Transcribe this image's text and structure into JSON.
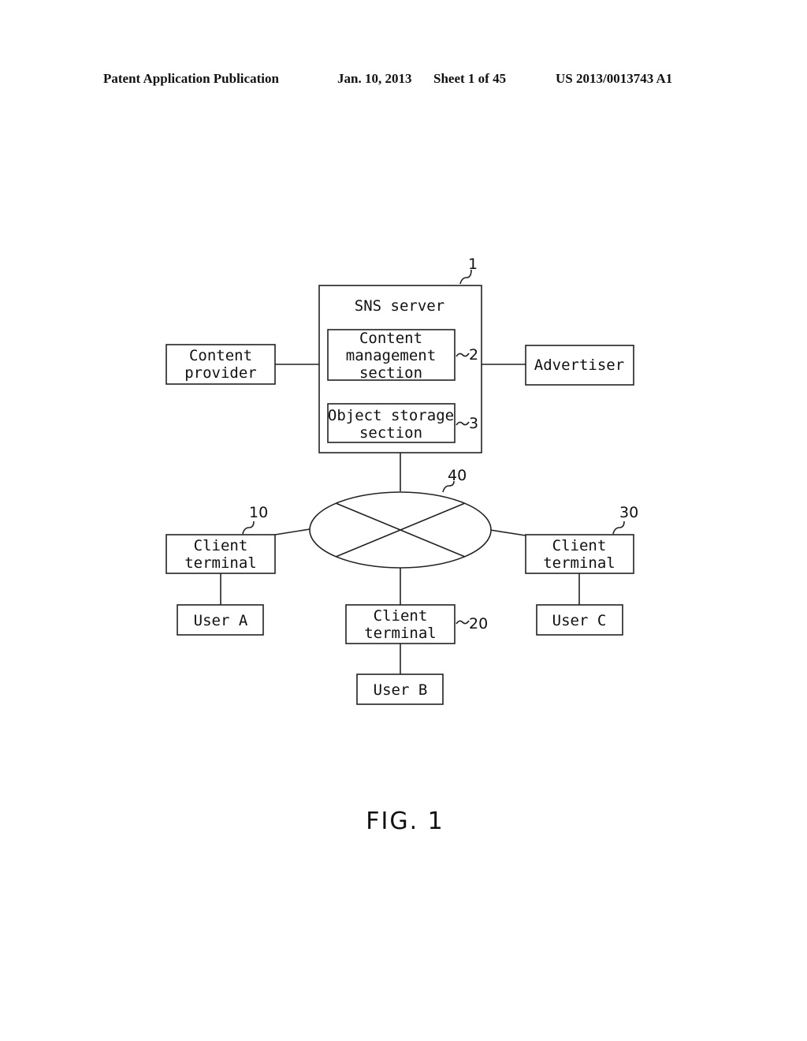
{
  "header": {
    "publication": "Patent Application Publication",
    "date": "Jan. 10, 2013",
    "sheet": "Sheet 1 of 45",
    "number": "US 2013/0013743 A1"
  },
  "diagram": {
    "sns_server": {
      "title": "SNS server",
      "ref": "1"
    },
    "content_management": {
      "lines": [
        "Content",
        "management",
        "section"
      ],
      "ref": "2"
    },
    "object_storage": {
      "lines": [
        "Object storage",
        "section"
      ],
      "ref": "3"
    },
    "content_provider": {
      "lines": [
        "Content",
        "provider"
      ]
    },
    "advertiser": {
      "label": "Advertiser"
    },
    "network": {
      "ref": "40"
    },
    "client_a": {
      "lines": [
        "Client",
        "terminal"
      ],
      "ref": "10"
    },
    "client_b": {
      "lines": [
        "Client",
        "terminal"
      ],
      "ref": "20"
    },
    "client_c": {
      "lines": [
        "Client",
        "terminal"
      ],
      "ref": "30"
    },
    "user_a": {
      "label": "User A"
    },
    "user_b": {
      "label": "User B"
    },
    "user_c": {
      "label": "User C"
    }
  },
  "figure_label": "FIG. 1"
}
